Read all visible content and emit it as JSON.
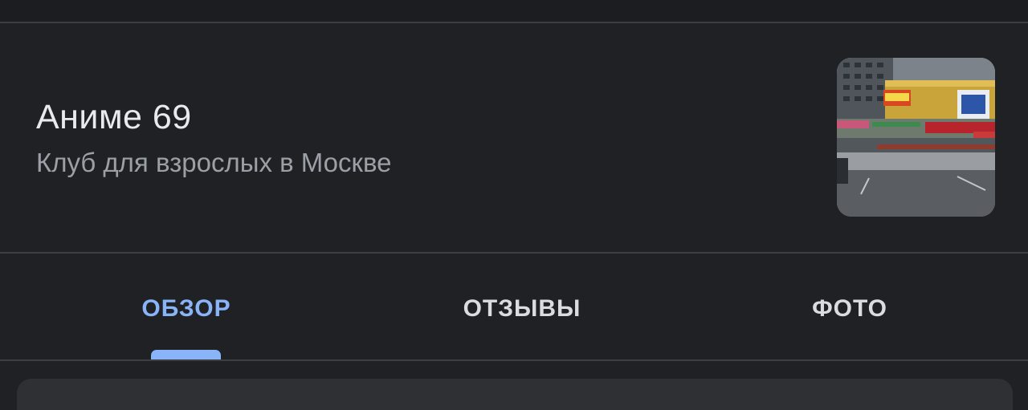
{
  "place": {
    "title": "Аниме 69",
    "subtitle": "Клуб для взрослых в Москве"
  },
  "thumbnail": {
    "alt": "storefront-photo"
  },
  "tabs": [
    {
      "label": "ОБЗОР",
      "active": true
    },
    {
      "label": "ОТЗЫВЫ",
      "active": false
    },
    {
      "label": "ФОТО",
      "active": false
    }
  ],
  "colors": {
    "background": "#202124",
    "accent": "#8ab4f8",
    "title": "#e8eaed",
    "subtitle": "#9aa0a6",
    "divider": "#3c3e43",
    "card": "#2f3033"
  }
}
